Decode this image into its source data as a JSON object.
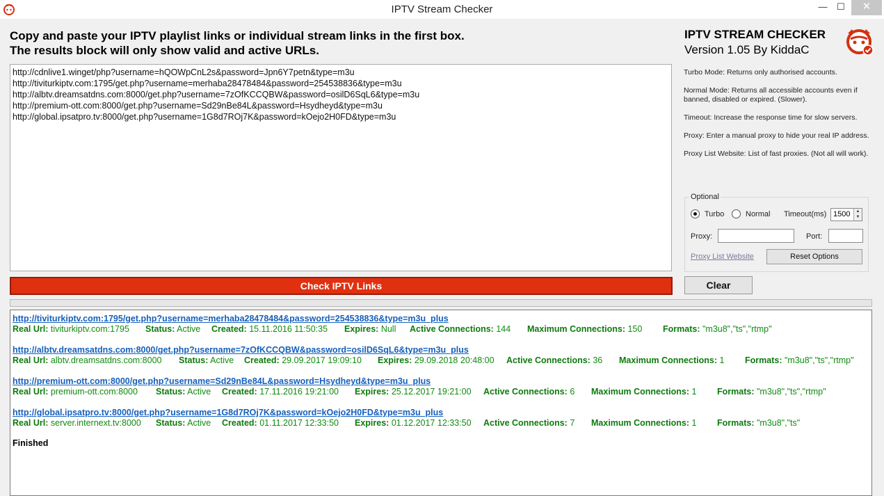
{
  "window": {
    "title": "IPTV Stream Checker",
    "minimize": "—",
    "maximize": "☐",
    "close": "✕"
  },
  "instructions": {
    "line1": "Copy and paste your IPTV playlist links or individual stream links in the first box.",
    "line2": "The results block will only show valid and active URLs."
  },
  "input_links": [
    "http://cdnlive1.winget/php?username=hQOWpCnL2s&password=Jpn6Y7petn&type=m3u",
    "http://tiviturkiptv.com:1795/get.php?username=merhaba28478484&password=254538836&type=m3u",
    "http://albtv.dreamsatdns.com:8000/get.php?username=7zOfKCCQBW&password=osilD6SqL6&type=m3u",
    "http://premium-ott.com:8000/get.php?username=Sd29nBe84L&password=Hsydheyd&type=m3u",
    "http://global.ipsatpro.tv:8000/get.php?username=1G8d7ROj7K&password=kOejo2H0FD&type=m3u"
  ],
  "buttons": {
    "check": "Check IPTV Links",
    "clear": "Clear",
    "reset": "Reset Options"
  },
  "side": {
    "title": "IPTV STREAM CHECKER",
    "version": "Version 1.05 By KiddaC",
    "modes": [
      "Turbo Mode:  Returns only authorised accounts.",
      "Normal Mode: Returns all accessible accounts even if banned, disabled or expired. (Slower).",
      "Timeout:  Increase the response time for slow servers.",
      "Proxy: Enter a manual proxy to hide your real IP address.",
      "Proxy List Website: List of fast proxies. (Not all will work)."
    ]
  },
  "options": {
    "legend": "Optional",
    "turbo_label": "Turbo",
    "normal_label": "Normal",
    "selected_mode": "Turbo",
    "timeout_label": "Timeout(ms)",
    "timeout_value": "1500",
    "proxy_label": "Proxy:",
    "proxy_value": "",
    "port_label": "Port:",
    "port_value": "",
    "proxy_list_link": "Proxy List Website"
  },
  "field_labels": {
    "real_url": "Real Url:",
    "status": "Status:",
    "created": "Created:",
    "expires": "Expires:",
    "active_connections": "Active Connections:",
    "max_connections": "Maximum Connections:",
    "formats": "Formats:"
  },
  "results": [
    {
      "url": "http://tiviturkiptv.com:1795/get.php?username=merhaba28478484&password=254538836&type=m3u_plus",
      "real_url": "tiviturkiptv.com:1795",
      "status": "Active",
      "created": "15.11.2016 11:50:35",
      "expires": "Null",
      "active_connections": "144",
      "max_connections": "150",
      "formats": "\"m3u8\",\"ts\",\"rtmp\""
    },
    {
      "url": "http://albtv.dreamsatdns.com:8000/get.php?username=7zOfKCCQBW&password=osilD6SqL6&type=m3u_plus",
      "real_url": "albtv.dreamsatdns.com:8000",
      "status": "Active",
      "created": "29.09.2017 19:09:10",
      "expires": "29.09.2018 20:48:00",
      "active_connections": "36",
      "max_connections": "1",
      "formats": "\"m3u8\",\"ts\",\"rtmp\""
    },
    {
      "url": "http://premium-ott.com:8000/get.php?username=Sd29nBe84L&password=Hsydheyd&type=m3u_plus",
      "real_url": "premium-ott.com:8000",
      "status": "Active",
      "created": "17.11.2016 19:21:00",
      "expires": "25.12.2017 19:21:00",
      "active_connections": "6",
      "max_connections": "1",
      "formats": "\"m3u8\",\"ts\",\"rtmp\""
    },
    {
      "url": "http://global.ipsatpro.tv:8000/get.php?username=1G8d7ROj7K&password=kOejo2H0FD&type=m3u_plus",
      "real_url": "server.internext.tv:8000",
      "status": "Active",
      "created": "01.11.2017 12:33:50",
      "expires": "01.12.2017 12:33:50",
      "active_connections": "7",
      "max_connections": "1",
      "formats": "\"m3u8\",\"ts\""
    }
  ],
  "finished_text": "Finished",
  "colors": {
    "check_button": "#e03010",
    "result_link": "#1560bd",
    "result_info": "#108a10"
  }
}
